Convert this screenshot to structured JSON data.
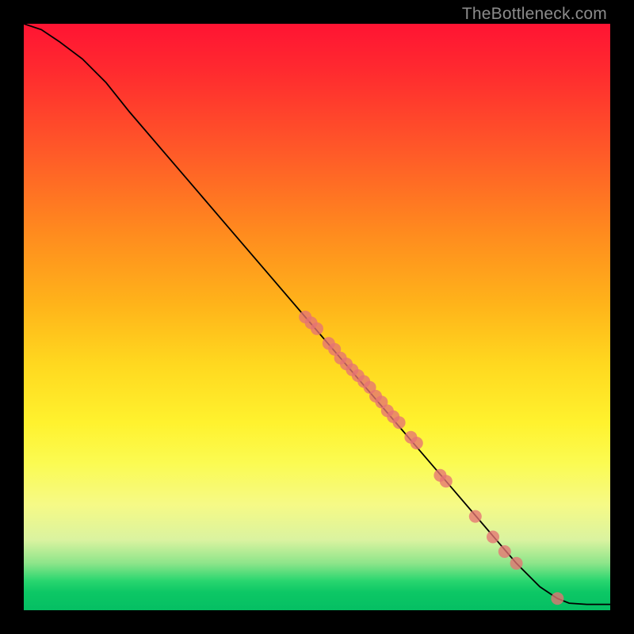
{
  "watermark": "TheBottleneck.com",
  "chart_data": {
    "type": "line",
    "title": "",
    "xlabel": "",
    "ylabel": "",
    "xlim": [
      0,
      100
    ],
    "ylim": [
      0,
      100
    ],
    "grid": false,
    "legend": null,
    "curve": {
      "x": [
        0,
        3,
        6,
        10,
        14,
        18,
        24,
        30,
        36,
        42,
        48,
        54,
        60,
        66,
        72,
        78,
        84,
        88,
        91,
        93,
        96,
        100
      ],
      "y": [
        100,
        99,
        97,
        94,
        90,
        85,
        78,
        71,
        64,
        57,
        50,
        43,
        36,
        29,
        22,
        15,
        8,
        4,
        2,
        1.2,
        1,
        1
      ]
    },
    "markers": {
      "x": [
        48,
        49,
        50,
        52,
        53,
        54,
        55,
        56,
        57,
        58,
        59,
        60,
        61,
        62,
        63,
        64,
        66,
        67,
        71,
        72,
        77,
        80,
        82,
        84,
        91
      ],
      "y": [
        50,
        49,
        48,
        45.5,
        44.5,
        43,
        42,
        41,
        40,
        39,
        38,
        36.5,
        35.5,
        34,
        33,
        32,
        29.5,
        28.5,
        23,
        22,
        16,
        12.5,
        10,
        8,
        2
      ]
    }
  }
}
